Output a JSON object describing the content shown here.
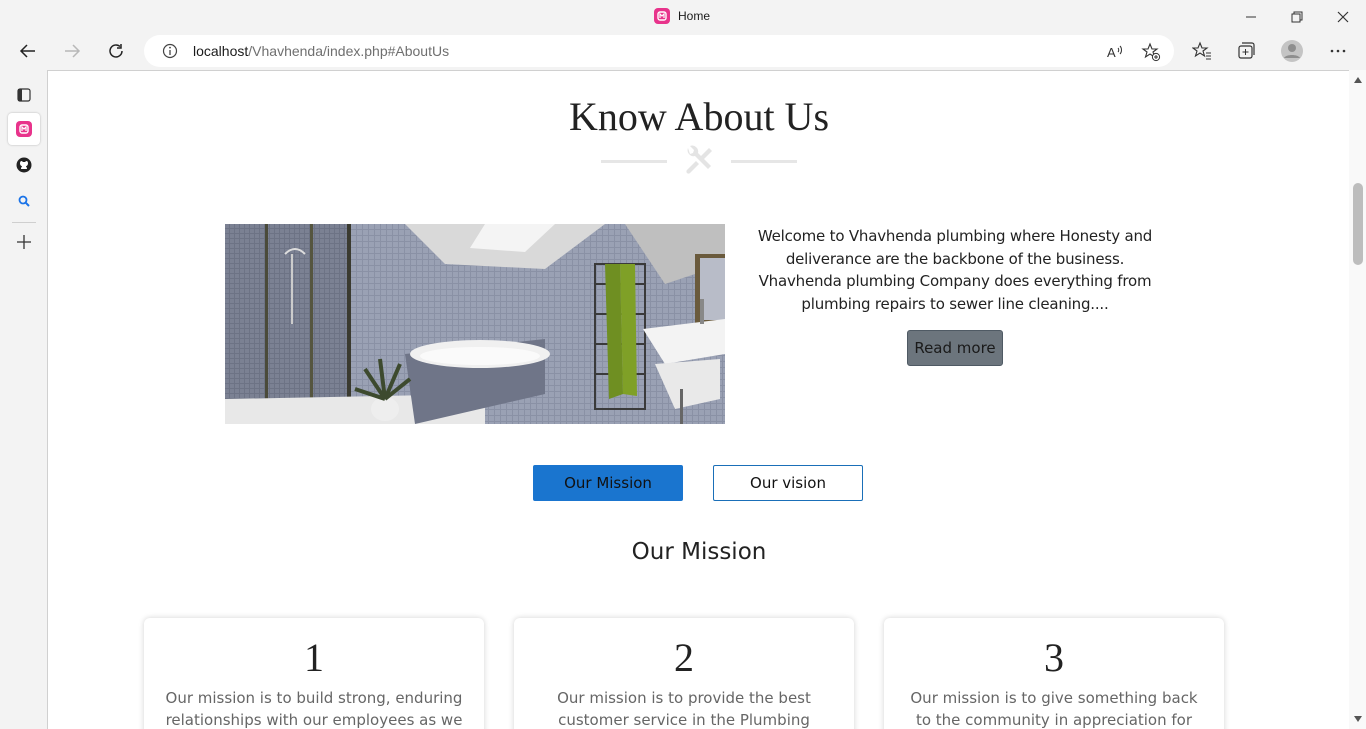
{
  "browser": {
    "tab_title": "Home",
    "url_host": "localhost",
    "url_path": "/Vhavhenda/index.php#AboutUs"
  },
  "about": {
    "title": "Know About Us",
    "text": "Welcome to Vhavhenda plumbing where Honesty and deliverance are the backbone of the business. Vhavhenda plumbing Company does everything from plumbing repairs to sewer line cleaning....",
    "read_more": "Read more"
  },
  "tabs": {
    "mission": "Our Mission",
    "vision": "Our vision"
  },
  "section": {
    "title": "Our Mission"
  },
  "cards": [
    {
      "num": "1",
      "text": "Our mission is to build strong, enduring relationships with our employees as we work"
    },
    {
      "num": "2",
      "text": "Our mission is to provide the best customer service in the Plumbing industry. Simplicity,"
    },
    {
      "num": "3",
      "text": "Our mission is to give something back to the community in appreciation for the"
    }
  ],
  "colors": {
    "primary": "#1a75cf",
    "secondary": "#6c757d",
    "favicon": "#e8338b"
  }
}
